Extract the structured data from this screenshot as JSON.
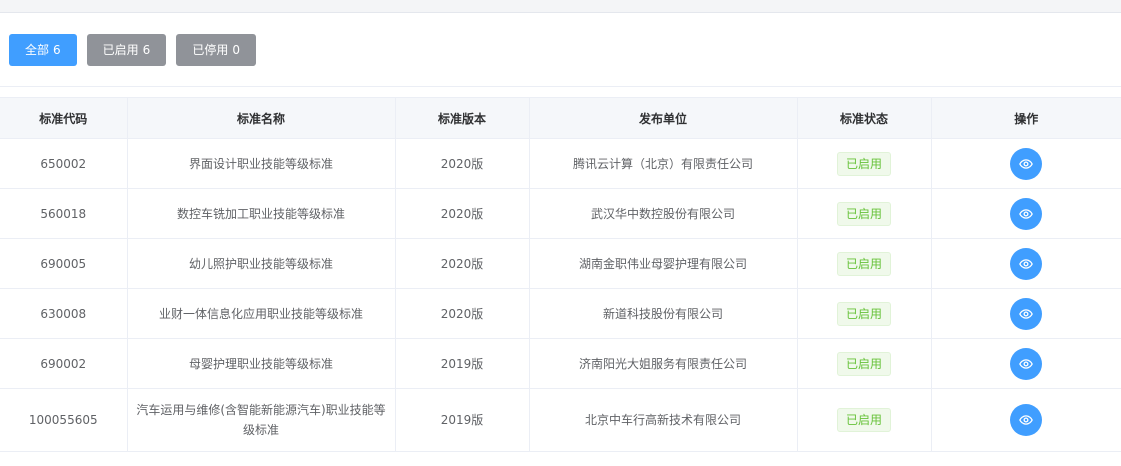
{
  "filters": [
    {
      "label": "全部",
      "count": "6",
      "active": true
    },
    {
      "label": "已启用",
      "count": "6",
      "active": false
    },
    {
      "label": "已停用",
      "count": "0",
      "active": false
    }
  ],
  "table": {
    "headers": {
      "code": "标准代码",
      "name": "标准名称",
      "version": "标准版本",
      "publisher": "发布单位",
      "status": "标准状态",
      "actions": "操作"
    },
    "rows": [
      {
        "code": "650002",
        "name": "界面设计职业技能等级标准",
        "version": "2020版",
        "publisher": "腾讯云计算（北京）有限责任公司",
        "status": "已启用"
      },
      {
        "code": "560018",
        "name": "数控车铣加工职业技能等级标准",
        "version": "2020版",
        "publisher": "武汉华中数控股份有限公司",
        "status": "已启用"
      },
      {
        "code": "690005",
        "name": "幼儿照护职业技能等级标准",
        "version": "2020版",
        "publisher": "湖南金职伟业母婴护理有限公司",
        "status": "已启用"
      },
      {
        "code": "630008",
        "name": "业财一体信息化应用职业技能等级标准",
        "version": "2020版",
        "publisher": "新道科技股份有限公司",
        "status": "已启用"
      },
      {
        "code": "690002",
        "name": "母婴护理职业技能等级标准",
        "version": "2019版",
        "publisher": "济南阳光大姐服务有限责任公司",
        "status": "已启用"
      },
      {
        "code": "100055605",
        "name": "汽车运用与维修(含智能新能源汽车)职业技能等级标准",
        "version": "2019版",
        "publisher": "北京中车行高新技术有限公司",
        "status": "已启用"
      }
    ]
  },
  "icons": {
    "view": "eye-icon"
  },
  "colors": {
    "primary": "#409eff",
    "inactive": "#909399",
    "success_text": "#67c23a",
    "success_bg": "#f0f9eb",
    "header_bg": "#f5f7fa"
  }
}
